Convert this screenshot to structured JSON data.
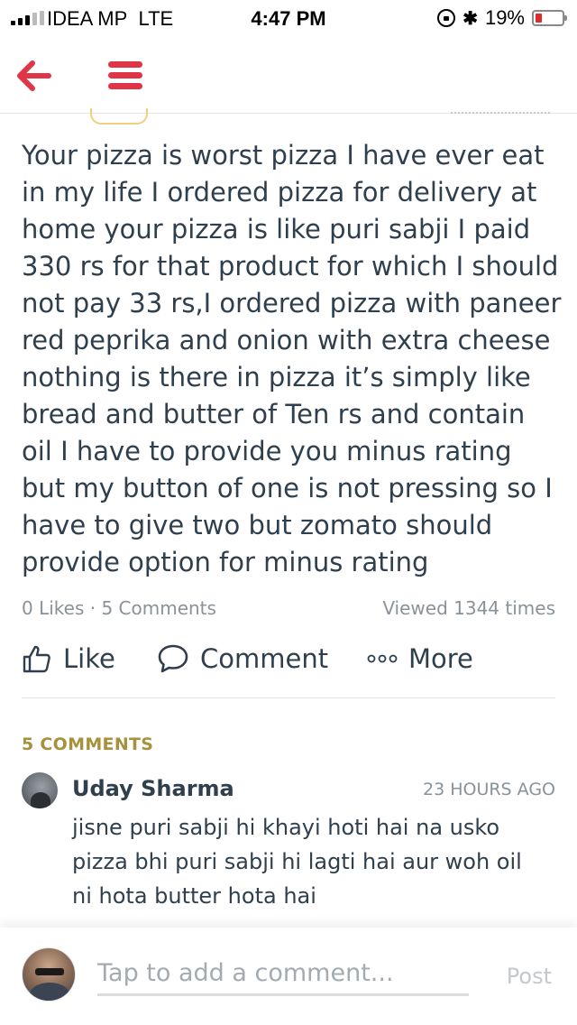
{
  "status_bar": {
    "carrier": "IDEA MP",
    "network": "LTE",
    "time": "4:47 PM",
    "battery": "19%",
    "bluetooth_icon": "bluetooth-icon",
    "battery_level": 0.19
  },
  "nav": {
    "back_icon": "back-arrow-icon",
    "menu_icon": "hamburger-menu-icon",
    "accent_color": "#e03546"
  },
  "review": {
    "text": "Your pizza is worst pizza I have ever eat in my life I ordered pizza for delivery at home your pizza is like puri sabji I paid 330 rs for that product for which I should not pay 33 rs,I ordered pizza with paneer red peprika and onion with extra cheese nothing is there in pizza it’s simply like bread and butter of Ten rs and contain oil I have to provide you minus rating but my button of one is not pressing so I have to give two but zomato should provide option for minus rating",
    "likes_comments": "0 Likes · 5 Comments",
    "views": "Viewed 1344 times"
  },
  "actions": {
    "like": "Like",
    "comment": "Comment",
    "more": "More"
  },
  "comments": {
    "header": "5 COMMENTS",
    "header_color": "#a8913d",
    "items": [
      {
        "name": "Uday Sharma",
        "time": "23 HOURS AGO",
        "text": "jisne puri sabji hi khayi hoti hai na usko pizza bhi puri sabji hi lagti hai aur woh oil ni hota butter hota hai"
      }
    ]
  },
  "composer": {
    "placeholder": "Tap to add a comment...",
    "post": "Post"
  }
}
